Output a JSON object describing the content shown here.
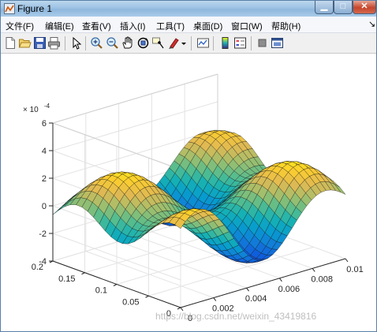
{
  "window": {
    "title": "Figure 1",
    "minimize_glyph": "▁",
    "maximize_glyph": "□",
    "close_glyph": "✕"
  },
  "menu": {
    "items": [
      "文件(F)",
      "编辑(E)",
      "查看(V)",
      "插入(I)",
      "工具(T)",
      "桌面(D)",
      "窗口(W)",
      "帮助(H)"
    ],
    "dock_arrow": "↘"
  },
  "toolbar": {
    "icons": [
      "new-figure-icon",
      "open-file-icon",
      "save-icon",
      "print-icon",
      "pointer-icon",
      "zoom-in-icon",
      "zoom-out-icon",
      "pan-hand-icon",
      "rotate-3d-icon",
      "data-cursor-icon",
      "brush-icon",
      "brush-dropdown-icon",
      "link-plot-icon",
      "colorbar-icon",
      "legend-icon",
      "hide-plot-tools-icon",
      "show-plot-tools-icon"
    ]
  },
  "chart_data": {
    "type": "surface",
    "colormap": "parula",
    "z_exponent_label": "× 10",
    "z_exponent_power": "-4",
    "x_ticks": [
      "0",
      "0.002",
      "0.004",
      "0.006",
      "0.008",
      "0.01"
    ],
    "y_ticks": [
      "0",
      "0.05",
      "0.1",
      "0.15",
      "0.2"
    ],
    "z_ticks": [
      "-4",
      "-2",
      "0",
      "2",
      "4",
      "6"
    ],
    "xlim": [
      0,
      0.01
    ],
    "ylim": [
      0,
      0.2
    ],
    "zlim": [
      -4,
      6
    ],
    "grid": true,
    "box": "partial",
    "view": "3d-default"
  },
  "watermark": "https://blog.csdn.net/weixin_43419816"
}
